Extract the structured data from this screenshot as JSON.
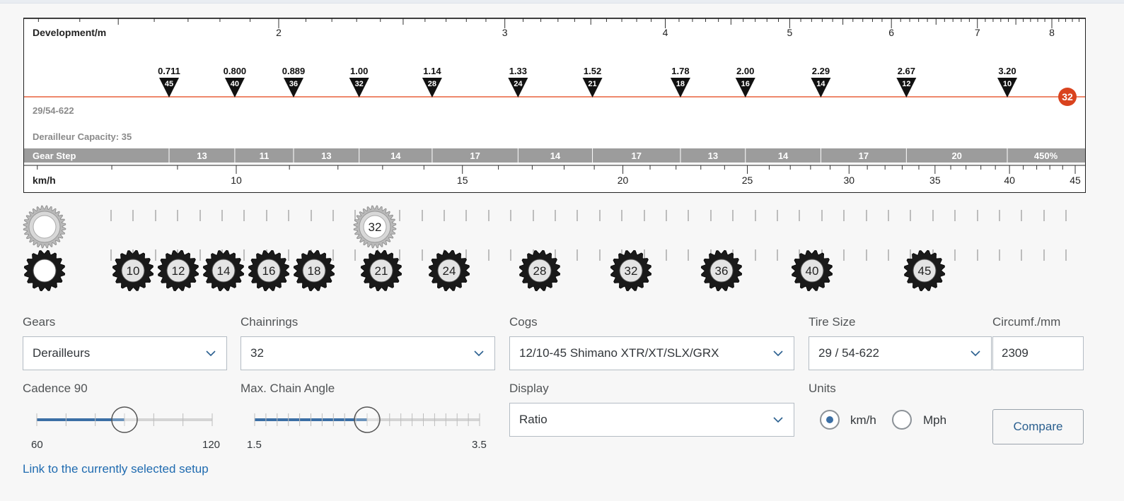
{
  "chart": {
    "dev_label": "Development/m",
    "dev_ticks": [
      "2",
      "3",
      "4",
      "5",
      "6",
      "7",
      "8"
    ],
    "tire_info": "29/54-622",
    "capacity": "Derailleur Capacity: 35",
    "gear_step_label": "Gear Step",
    "gear_steps": [
      "13",
      "11",
      "13",
      "14",
      "17",
      "14",
      "17",
      "13",
      "14",
      "17",
      "20",
      "450%"
    ],
    "speed_label": "km/h",
    "speed_ticks": [
      "10",
      "15",
      "20",
      "25",
      "30",
      "35",
      "40",
      "45"
    ],
    "markers": [
      {
        "ratio": "0.711",
        "cog": "45"
      },
      {
        "ratio": "0.800",
        "cog": "40"
      },
      {
        "ratio": "0.889",
        "cog": "36"
      },
      {
        "ratio": "1.00",
        "cog": "32"
      },
      {
        "ratio": "1.14",
        "cog": "28"
      },
      {
        "ratio": "1.33",
        "cog": "24"
      },
      {
        "ratio": "1.52",
        "cog": "21"
      },
      {
        "ratio": "1.78",
        "cog": "18"
      },
      {
        "ratio": "2.00",
        "cog": "16"
      },
      {
        "ratio": "2.29",
        "cog": "14"
      },
      {
        "ratio": "2.67",
        "cog": "12"
      },
      {
        "ratio": "3.20",
        "cog": "10"
      }
    ],
    "chainring_badge": "32",
    "line_color": "#e8603c",
    "badge_color": "#d9431e"
  },
  "drivetrain": {
    "selected_chainring": "32",
    "cogs": [
      "10",
      "12",
      "14",
      "16",
      "18",
      "21",
      "24",
      "28",
      "32",
      "36",
      "40",
      "45"
    ]
  },
  "form": {
    "gears_label": "Gears",
    "gears_value": "Derailleurs",
    "chainrings_label": "Chainrings",
    "chainrings_value": "32",
    "cogs_label": "Cogs",
    "cogs_value": "12/10-45 Shimano XTR/XT/SLX/GRX",
    "tire_label": "Tire Size",
    "tire_value": "29 / 54-622",
    "circ_label": "Circumf./mm",
    "circ_value": "2309",
    "cadence_label": "Cadence 90",
    "cadence_min": "60",
    "cadence_max": "120",
    "cadence_value": 90,
    "angle_label": "Max. Chain Angle",
    "angle_min": "1.5",
    "angle_max": "3.5",
    "angle_value": 2.5,
    "display_label": "Display",
    "display_value": "Ratio",
    "units_label": "Units",
    "unit_kmh": "km/h",
    "unit_mph": "Mph",
    "compare": "Compare",
    "link": "Link to the currently selected setup"
  }
}
